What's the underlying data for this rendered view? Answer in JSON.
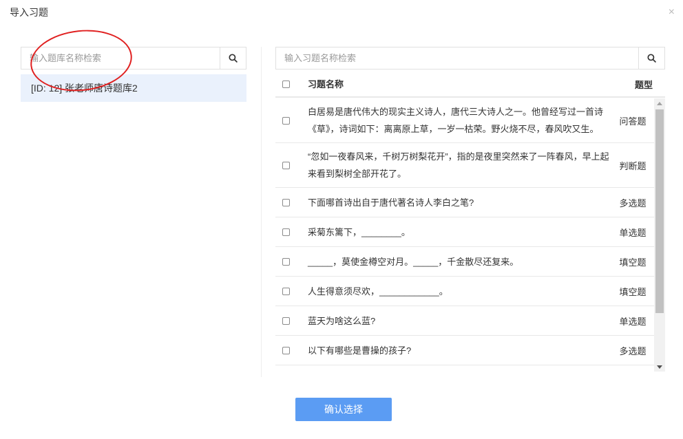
{
  "dialog": {
    "title": "导入习题",
    "close_symbol": "×"
  },
  "left_panel": {
    "search": {
      "placeholder": "输入题库名称检索",
      "value": ""
    },
    "banks": [
      {
        "label": "[ID: 12] 张老师唐诗题库2",
        "selected": true
      }
    ]
  },
  "right_panel": {
    "search": {
      "placeholder": "输入习题名称检索",
      "value": ""
    },
    "columns": {
      "name": "习题名称",
      "type": "题型"
    },
    "rows": [
      {
        "name": "白居易是唐代伟大的现实主义诗人，唐代三大诗人之一。他曾经写过一首诗《草》，诗词如下：离离原上草，一岁一枯荣。野火烧不尽，春风吹又生。",
        "type": "问答题"
      },
      {
        "name": "“忽如一夜春风来，千树万树梨花开”，指的是夜里突然来了一阵春风，早上起来看到梨树全部开花了。",
        "type": "判断题"
      },
      {
        "name": "下面哪首诗出自于唐代著名诗人李白之笔?",
        "type": "多选题"
      },
      {
        "name": "采菊东篱下，________。",
        "type": "单选题"
      },
      {
        "name": "_____，莫使金樽空对月。_____，千金散尽还复来。",
        "type": "填空题"
      },
      {
        "name": "人生得意须尽欢，____________。",
        "type": "填空题"
      },
      {
        "name": "蓝天为啥这么蓝?",
        "type": "单选题"
      },
      {
        "name": "以下有哪些是曹操的孩子?",
        "type": "多选题"
      }
    ]
  },
  "footer": {
    "confirm_label": "确认选择"
  },
  "colors": {
    "primary": "#5b9cf3",
    "selected_bg": "#eaf1fc",
    "annotation": "#e02020"
  }
}
